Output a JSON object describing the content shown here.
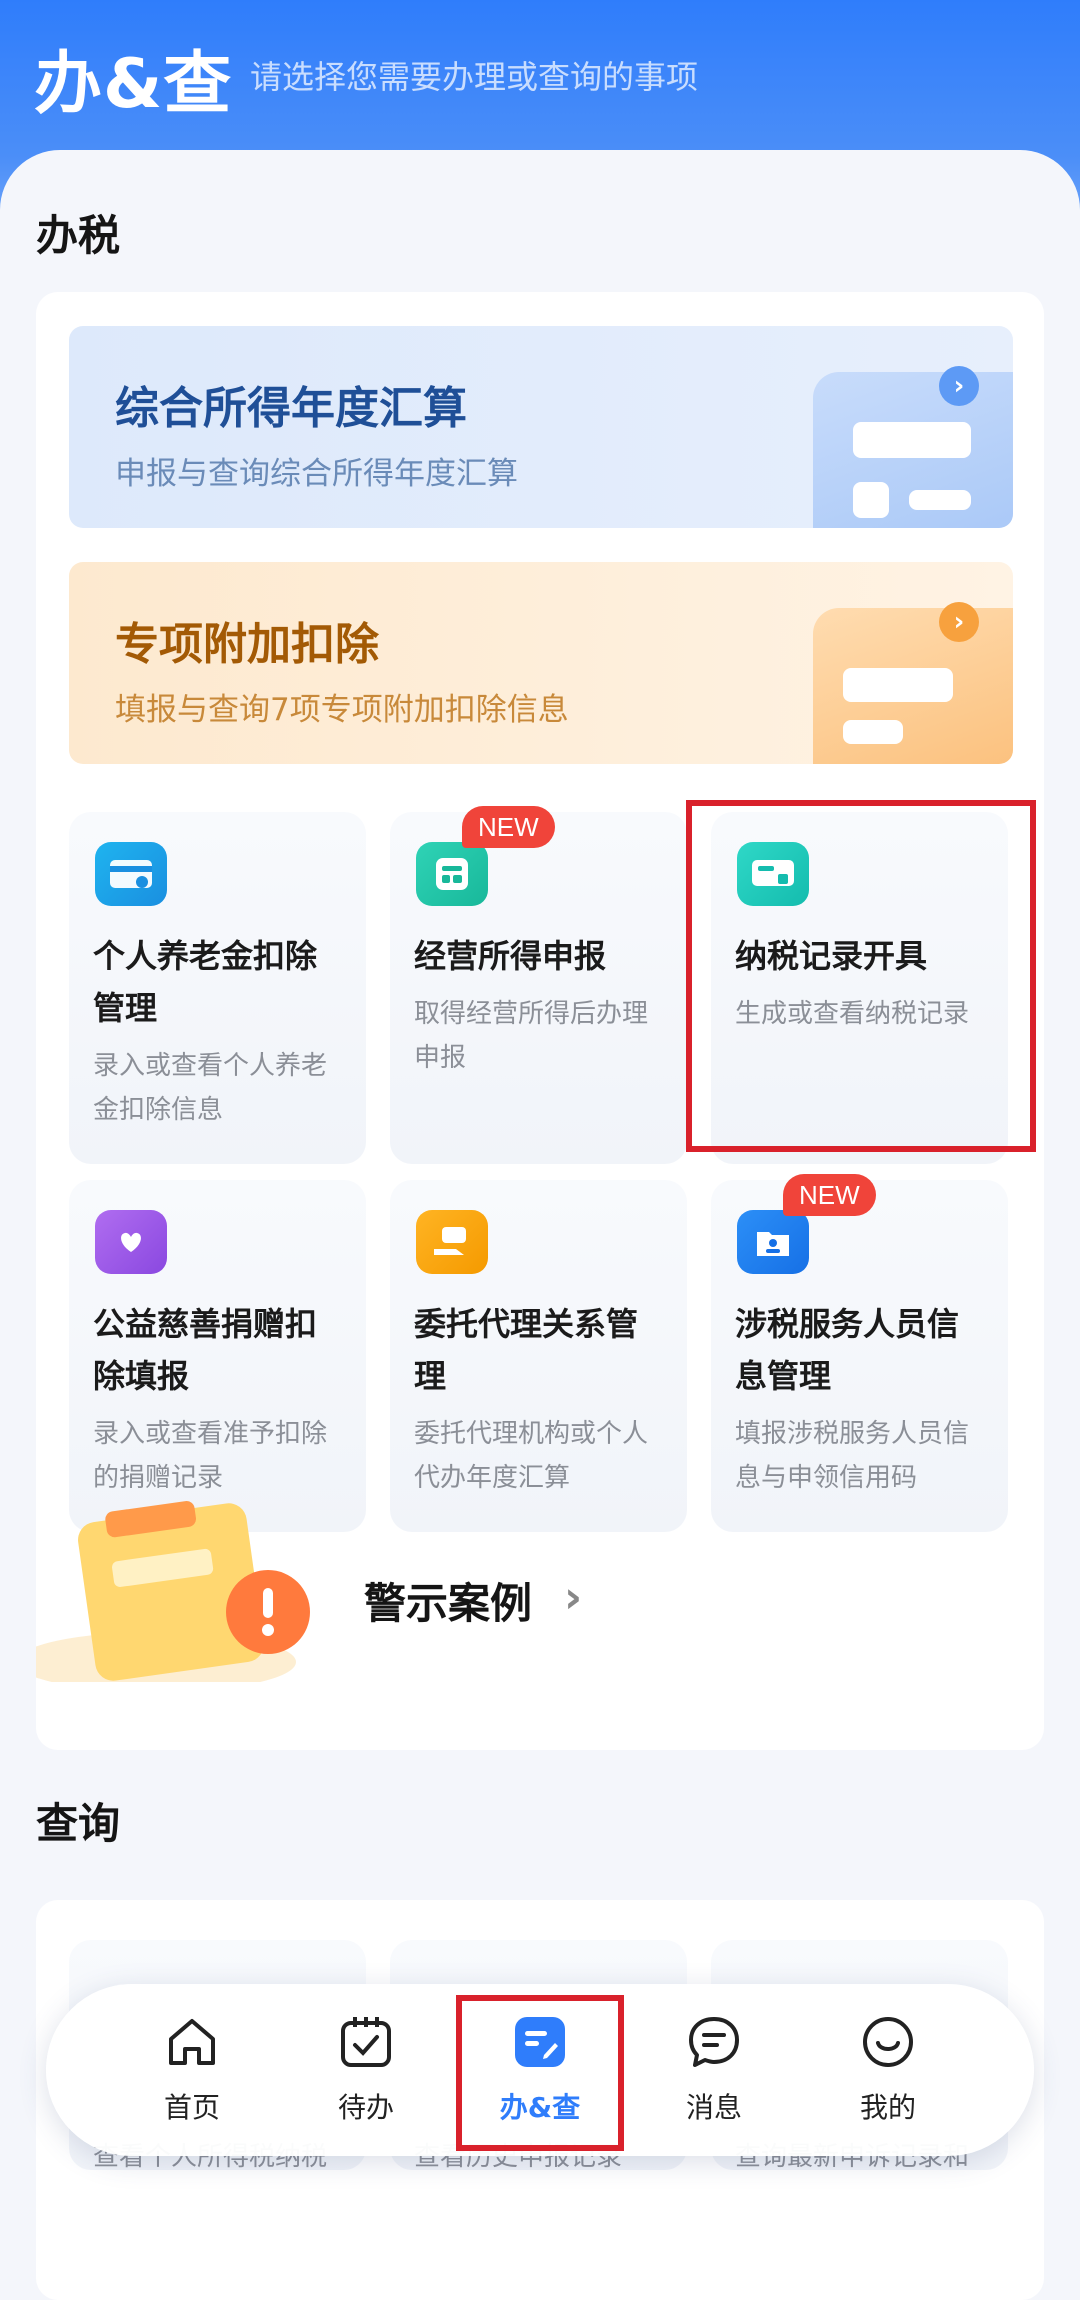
{
  "header": {
    "title": "办&查",
    "subtitle": "请选择您需要办理或查询的事项"
  },
  "sections": {
    "tax": "办税",
    "query": "查询"
  },
  "banners": [
    {
      "title": "综合所得年度汇算",
      "subtitle": "申报与查询综合所得年度汇算"
    },
    {
      "title": "专项附加扣除",
      "subtitle": "填报与查询7项专项附加扣除信息"
    }
  ],
  "tiles": [
    {
      "title": "个人养老金扣除管理",
      "desc": "录入或查看个人养老金扣除信息",
      "icon": "pension-card-icon"
    },
    {
      "title": "经营所得申报",
      "desc": "取得经营所得后办理申报",
      "icon": "business-income-icon",
      "badge": "NEW"
    },
    {
      "title": "纳税记录开具",
      "desc": "生成或查看纳税记录",
      "icon": "tax-record-icon"
    },
    {
      "title": "公益慈善捐赠扣除填报",
      "desc": "录入或查看准予扣除的捐赠记录",
      "icon": "charity-donation-icon"
    },
    {
      "title": "委托代理关系管理",
      "desc": "委托代理机构或个人代办年度汇算",
      "icon": "agency-delegate-icon"
    },
    {
      "title": "涉税服务人员信息管理",
      "desc": "填报涉税服务人员信息与申领信用码",
      "icon": "tax-service-staff-icon",
      "badge": "NEW"
    }
  ],
  "warning": {
    "label": "警示案例"
  },
  "query_peek": [
    {
      "desc": "查看个人所得税纳税"
    },
    {
      "desc": "查看历史申报记录"
    },
    {
      "desc": "查询最新申诉记录和"
    }
  ],
  "nav": [
    {
      "label": "首页",
      "icon": "home-icon"
    },
    {
      "label": "待办",
      "icon": "todo-calendar-icon"
    },
    {
      "label": "办&查",
      "icon": "handle-query-icon",
      "active": true
    },
    {
      "label": "消息",
      "icon": "message-icon"
    },
    {
      "label": "我的",
      "icon": "profile-smile-icon"
    }
  ],
  "colors": {
    "accent": "#2f7dfb",
    "highlight_box": "#d9212b",
    "new_badge": "#f0443a"
  }
}
